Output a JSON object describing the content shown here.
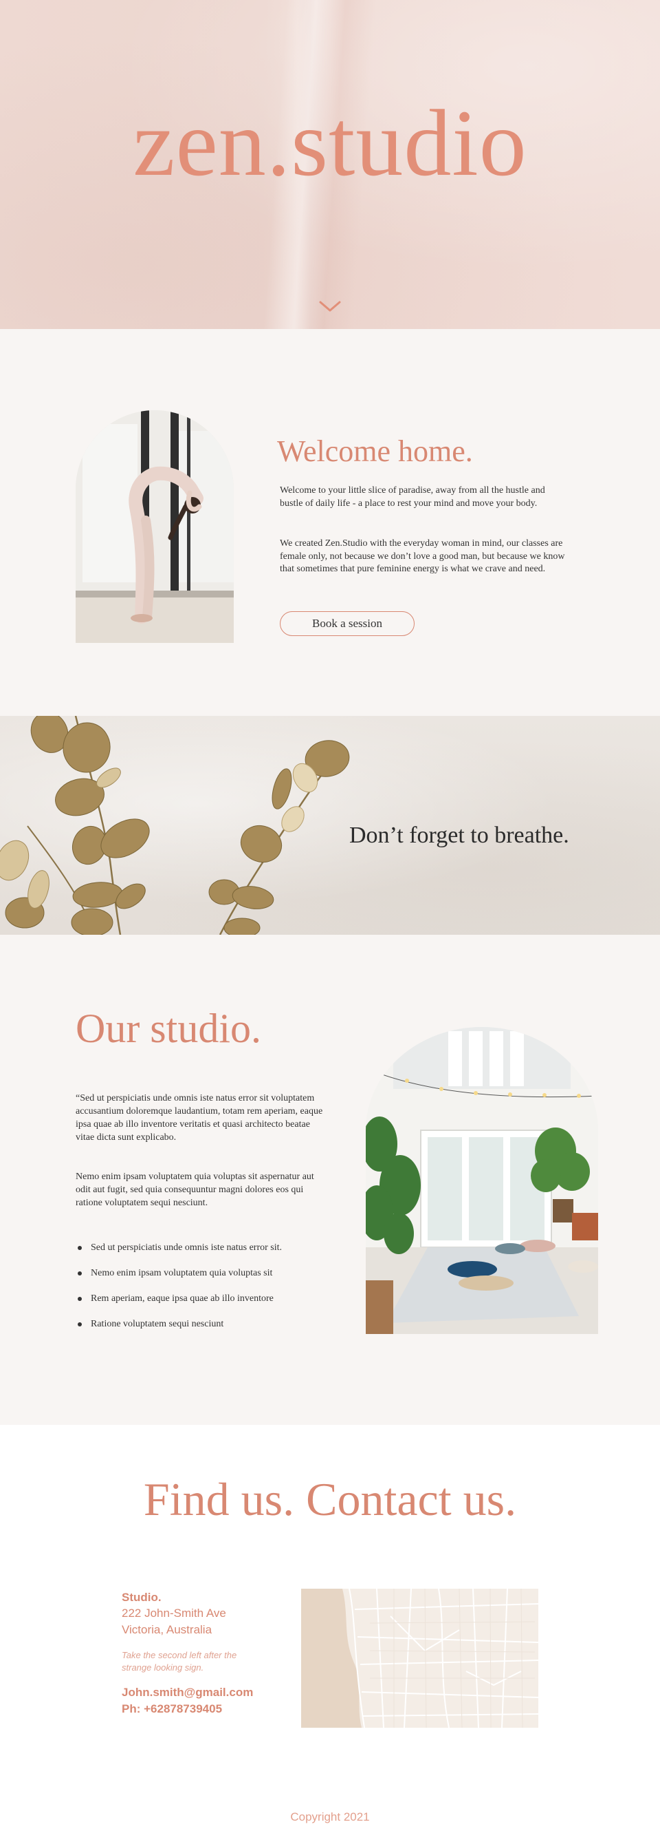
{
  "hero": {
    "brand": "zen.studio",
    "scroll_icon": "chevron-down-icon"
  },
  "welcome": {
    "title": "Welcome home.",
    "paragraph_1": "Welcome to your little slice of paradise, away from all the hustle and bustle of daily life - a place to rest your mind and move your body.",
    "paragraph_2": "We created Zen.Studio with the everyday woman in mind, our classes are female only, not because we don’t love a good man, but because we know that sometimes that pure feminine energy is what we crave and need.",
    "cta_label": "Book a session"
  },
  "breathe": {
    "text": "Don’t forget to breathe."
  },
  "studio": {
    "title": "Our studio.",
    "paragraph_1": "“Sed ut perspiciatis unde omnis iste natus error sit voluptatem accusantium doloremque laudantium, totam rem aperiam, eaque ipsa quae ab illo inventore veritatis et quasi architecto beatae vitae dicta sunt explicabo.",
    "paragraph_2": " Nemo enim ipsam voluptatem quia voluptas sit aspernatur aut odit aut fugit, sed quia consequuntur magni dolores eos qui ratione voluptatem sequi nesciunt.",
    "list": [
      "Sed ut perspiciatis unde omnis iste natus error sit.",
      "Nemo enim ipsam voluptatem quia voluptas sit",
      "Rem aperiam, eaque ipsa quae ab illo inventore",
      "Ratione voluptatem sequi nesciunt"
    ]
  },
  "contact": {
    "title": "Find us. Contact us.",
    "name": "Studio.",
    "address_1": "222 John-Smith Ave",
    "address_2": "Victoria, Australia",
    "note": "Take the second left after the strange looking sign.",
    "email": "John.smith@gmail.com",
    "phone": "Ph: +62878739405",
    "copyright": "Copyright 2021"
  },
  "colors": {
    "accent": "#d88872",
    "hero_title": "#e28f78",
    "background": "#f8f5f3"
  }
}
